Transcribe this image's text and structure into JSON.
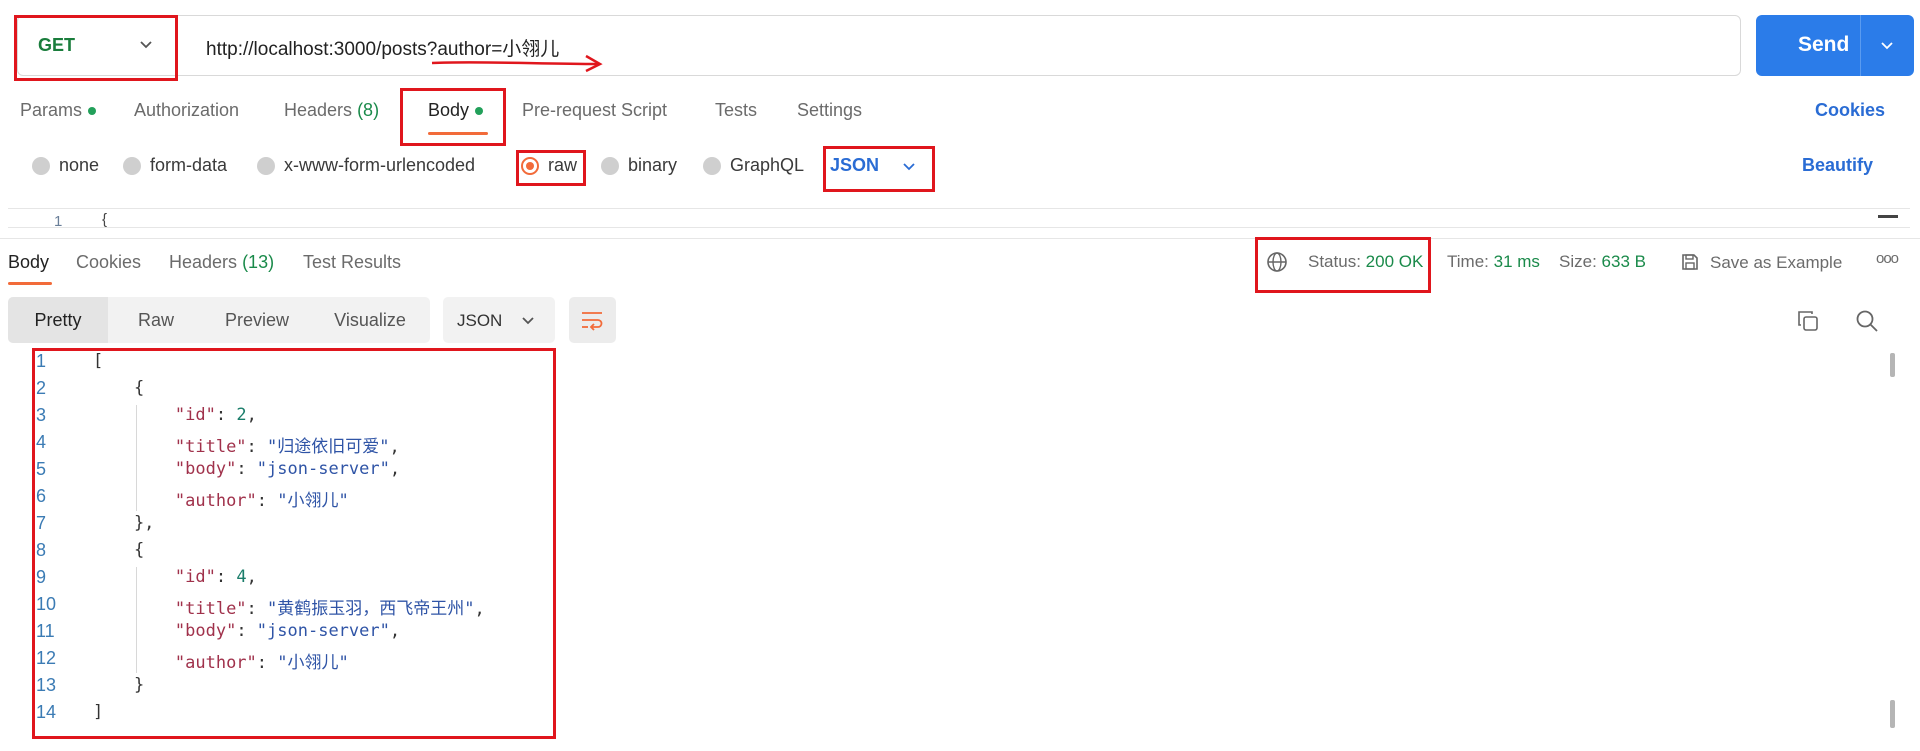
{
  "request": {
    "method": "GET",
    "url": "http://localhost:3000/posts?author=小翎儿",
    "send_label": "Send"
  },
  "request_tabs": {
    "params": "Params",
    "authorization": "Authorization",
    "headers": "Headers",
    "headers_count": "(8)",
    "body": "Body",
    "prerequest": "Pre-request Script",
    "tests": "Tests",
    "settings": "Settings",
    "cookies": "Cookies"
  },
  "body_modes": {
    "none": "none",
    "form_data": "form-data",
    "urlencoded": "x-www-form-urlencoded",
    "raw": "raw",
    "binary": "binary",
    "graphql": "GraphQL",
    "language": "JSON",
    "beautify": "Beautify"
  },
  "request_editor": {
    "line": "1",
    "text": "{"
  },
  "response_tabs": {
    "body": "Body",
    "cookies": "Cookies",
    "headers": "Headers",
    "headers_count": "(13)",
    "test_results": "Test Results"
  },
  "response_meta": {
    "status_label": "Status:",
    "status_value": "200 OK",
    "time_label": "Time:",
    "time_value": "31 ms",
    "size_label": "Size:",
    "size_value": "633 B",
    "save_example": "Save as Example",
    "more": "ooo"
  },
  "format": {
    "pretty": "Pretty",
    "raw": "Raw",
    "preview": "Preview",
    "visualize": "Visualize",
    "language": "JSON"
  },
  "response_body": {
    "lines": [
      {
        "n": "1",
        "parts": [
          [
            "p",
            "["
          ]
        ]
      },
      {
        "n": "2",
        "parts": [
          [
            "p",
            "    {"
          ]
        ]
      },
      {
        "n": "3",
        "parts": [
          [
            "p",
            "        "
          ],
          [
            "k",
            "\"id\""
          ],
          [
            "p",
            ": "
          ],
          [
            "num",
            "2"
          ],
          [
            "p",
            ","
          ]
        ]
      },
      {
        "n": "4",
        "parts": [
          [
            "p",
            "        "
          ],
          [
            "k",
            "\"title\""
          ],
          [
            "p",
            ": "
          ],
          [
            "s",
            "\"归途依旧可爱\""
          ],
          [
            "p",
            ","
          ]
        ]
      },
      {
        "n": "5",
        "parts": [
          [
            "p",
            "        "
          ],
          [
            "k",
            "\"body\""
          ],
          [
            "p",
            ": "
          ],
          [
            "s",
            "\"json-server\""
          ],
          [
            "p",
            ","
          ]
        ]
      },
      {
        "n": "6",
        "parts": [
          [
            "p",
            "        "
          ],
          [
            "k",
            "\"author\""
          ],
          [
            "p",
            ": "
          ],
          [
            "s",
            "\"小翎儿\""
          ]
        ]
      },
      {
        "n": "7",
        "parts": [
          [
            "p",
            "    },"
          ]
        ]
      },
      {
        "n": "8",
        "parts": [
          [
            "p",
            "    {"
          ]
        ]
      },
      {
        "n": "9",
        "parts": [
          [
            "p",
            "        "
          ],
          [
            "k",
            "\"id\""
          ],
          [
            "p",
            ": "
          ],
          [
            "num",
            "4"
          ],
          [
            "p",
            ","
          ]
        ]
      },
      {
        "n": "10",
        "parts": [
          [
            "p",
            "        "
          ],
          [
            "k",
            "\"title\""
          ],
          [
            "p",
            ": "
          ],
          [
            "s",
            "\"黄鹤振玉羽，西飞帝王州\""
          ],
          [
            "p",
            ","
          ]
        ]
      },
      {
        "n": "11",
        "parts": [
          [
            "p",
            "        "
          ],
          [
            "k",
            "\"body\""
          ],
          [
            "p",
            ": "
          ],
          [
            "s",
            "\"json-server\""
          ],
          [
            "p",
            ","
          ]
        ]
      },
      {
        "n": "12",
        "parts": [
          [
            "p",
            "        "
          ],
          [
            "k",
            "\"author\""
          ],
          [
            "p",
            ": "
          ],
          [
            "s",
            "\"小翎儿\""
          ]
        ]
      },
      {
        "n": "13",
        "parts": [
          [
            "p",
            "    }"
          ]
        ]
      },
      {
        "n": "14",
        "parts": [
          [
            "p",
            "]"
          ]
        ]
      }
    ]
  },
  "colors": {
    "accent_orange": "#f26b3a",
    "send_blue": "#2b7ce9",
    "status_green": "#1a8a4a",
    "annotation_red": "#e0161d"
  }
}
